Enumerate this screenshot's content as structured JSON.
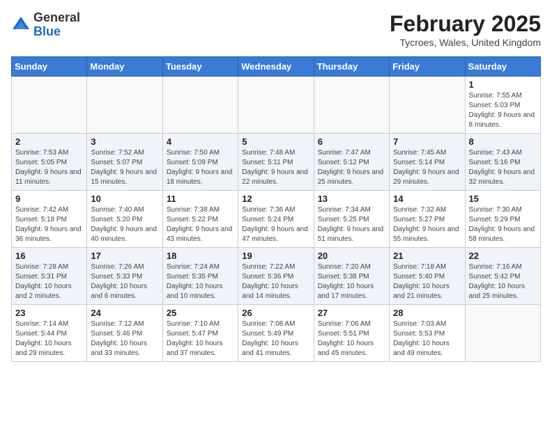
{
  "header": {
    "logo": {
      "general": "General",
      "blue": "Blue"
    },
    "title": "February 2025",
    "location": "Tycroes, Wales, United Kingdom"
  },
  "calendar": {
    "days_of_week": [
      "Sunday",
      "Monday",
      "Tuesday",
      "Wednesday",
      "Thursday",
      "Friday",
      "Saturday"
    ],
    "weeks": [
      {
        "shaded": false,
        "days": [
          {
            "num": "",
            "info": ""
          },
          {
            "num": "",
            "info": ""
          },
          {
            "num": "",
            "info": ""
          },
          {
            "num": "",
            "info": ""
          },
          {
            "num": "",
            "info": ""
          },
          {
            "num": "",
            "info": ""
          },
          {
            "num": "1",
            "info": "Sunrise: 7:55 AM\nSunset: 5:03 PM\nDaylight: 9 hours and 8 minutes."
          }
        ]
      },
      {
        "shaded": true,
        "days": [
          {
            "num": "2",
            "info": "Sunrise: 7:53 AM\nSunset: 5:05 PM\nDaylight: 9 hours and 11 minutes."
          },
          {
            "num": "3",
            "info": "Sunrise: 7:52 AM\nSunset: 5:07 PM\nDaylight: 9 hours and 15 minutes."
          },
          {
            "num": "4",
            "info": "Sunrise: 7:50 AM\nSunset: 5:09 PM\nDaylight: 9 hours and 18 minutes."
          },
          {
            "num": "5",
            "info": "Sunrise: 7:48 AM\nSunset: 5:11 PM\nDaylight: 9 hours and 22 minutes."
          },
          {
            "num": "6",
            "info": "Sunrise: 7:47 AM\nSunset: 5:12 PM\nDaylight: 9 hours and 25 minutes."
          },
          {
            "num": "7",
            "info": "Sunrise: 7:45 AM\nSunset: 5:14 PM\nDaylight: 9 hours and 29 minutes."
          },
          {
            "num": "8",
            "info": "Sunrise: 7:43 AM\nSunset: 5:16 PM\nDaylight: 9 hours and 32 minutes."
          }
        ]
      },
      {
        "shaded": false,
        "days": [
          {
            "num": "9",
            "info": "Sunrise: 7:42 AM\nSunset: 5:18 PM\nDaylight: 9 hours and 36 minutes."
          },
          {
            "num": "10",
            "info": "Sunrise: 7:40 AM\nSunset: 5:20 PM\nDaylight: 9 hours and 40 minutes."
          },
          {
            "num": "11",
            "info": "Sunrise: 7:38 AM\nSunset: 5:22 PM\nDaylight: 9 hours and 43 minutes."
          },
          {
            "num": "12",
            "info": "Sunrise: 7:36 AM\nSunset: 5:24 PM\nDaylight: 9 hours and 47 minutes."
          },
          {
            "num": "13",
            "info": "Sunrise: 7:34 AM\nSunset: 5:25 PM\nDaylight: 9 hours and 51 minutes."
          },
          {
            "num": "14",
            "info": "Sunrise: 7:32 AM\nSunset: 5:27 PM\nDaylight: 9 hours and 55 minutes."
          },
          {
            "num": "15",
            "info": "Sunrise: 7:30 AM\nSunset: 5:29 PM\nDaylight: 9 hours and 58 minutes."
          }
        ]
      },
      {
        "shaded": true,
        "days": [
          {
            "num": "16",
            "info": "Sunrise: 7:28 AM\nSunset: 5:31 PM\nDaylight: 10 hours and 2 minutes."
          },
          {
            "num": "17",
            "info": "Sunrise: 7:26 AM\nSunset: 5:33 PM\nDaylight: 10 hours and 6 minutes."
          },
          {
            "num": "18",
            "info": "Sunrise: 7:24 AM\nSunset: 5:35 PM\nDaylight: 10 hours and 10 minutes."
          },
          {
            "num": "19",
            "info": "Sunrise: 7:22 AM\nSunset: 5:36 PM\nDaylight: 10 hours and 14 minutes."
          },
          {
            "num": "20",
            "info": "Sunrise: 7:20 AM\nSunset: 5:38 PM\nDaylight: 10 hours and 17 minutes."
          },
          {
            "num": "21",
            "info": "Sunrise: 7:18 AM\nSunset: 5:40 PM\nDaylight: 10 hours and 21 minutes."
          },
          {
            "num": "22",
            "info": "Sunrise: 7:16 AM\nSunset: 5:42 PM\nDaylight: 10 hours and 25 minutes."
          }
        ]
      },
      {
        "shaded": false,
        "days": [
          {
            "num": "23",
            "info": "Sunrise: 7:14 AM\nSunset: 5:44 PM\nDaylight: 10 hours and 29 minutes."
          },
          {
            "num": "24",
            "info": "Sunrise: 7:12 AM\nSunset: 5:46 PM\nDaylight: 10 hours and 33 minutes."
          },
          {
            "num": "25",
            "info": "Sunrise: 7:10 AM\nSunset: 5:47 PM\nDaylight: 10 hours and 37 minutes."
          },
          {
            "num": "26",
            "info": "Sunrise: 7:08 AM\nSunset: 5:49 PM\nDaylight: 10 hours and 41 minutes."
          },
          {
            "num": "27",
            "info": "Sunrise: 7:06 AM\nSunset: 5:51 PM\nDaylight: 10 hours and 45 minutes."
          },
          {
            "num": "28",
            "info": "Sunrise: 7:03 AM\nSunset: 5:53 PM\nDaylight: 10 hours and 49 minutes."
          },
          {
            "num": "",
            "info": ""
          }
        ]
      }
    ]
  }
}
